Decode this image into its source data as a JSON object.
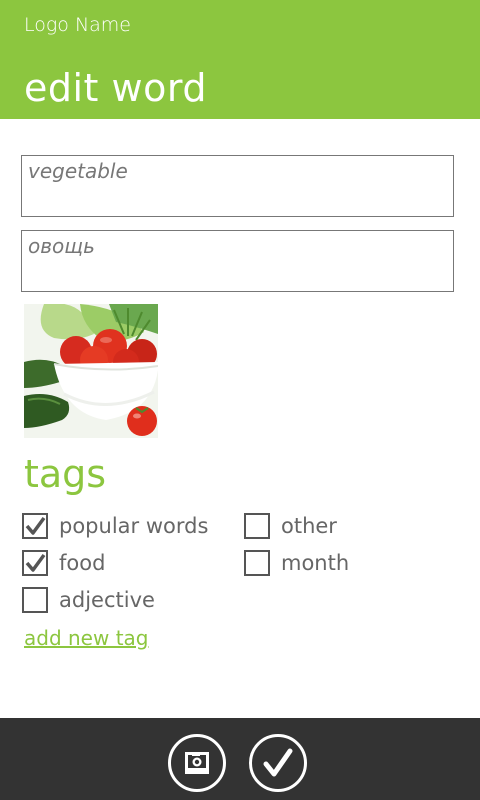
{
  "header": {
    "app_name": "Logo Name",
    "page_title": "edit word"
  },
  "form": {
    "word_value": "vegetable",
    "translation_value": "овощь"
  },
  "image": {
    "description": "vegetables-photo"
  },
  "tags": {
    "heading": "tags",
    "items": [
      {
        "label": "popular words",
        "checked": true
      },
      {
        "label": "food",
        "checked": true
      },
      {
        "label": "adjective",
        "checked": false
      },
      {
        "label": "other",
        "checked": false
      },
      {
        "label": "month",
        "checked": false
      }
    ],
    "add_link": "add new tag"
  },
  "appbar": {
    "buttons": [
      {
        "icon": "camera-icon"
      },
      {
        "icon": "checkmark-icon"
      }
    ]
  },
  "colors": {
    "accent": "#8cc63f",
    "appbar": "#333333",
    "text": "#555555"
  }
}
